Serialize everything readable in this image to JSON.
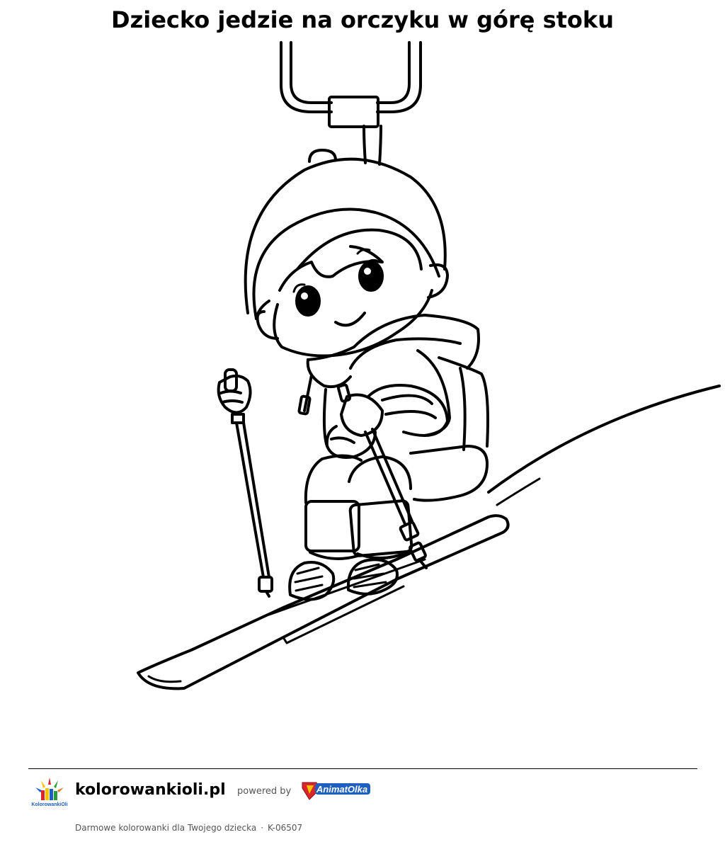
{
  "page": {
    "title": "Dziecko jedzie na orczyku w górę stoku"
  },
  "illustration": {
    "subject": "child-on-t-bar-lift",
    "style": "black-outline-coloring-page"
  },
  "footer": {
    "site_name": "kolorowankioli.pl",
    "powered_by": "powered by",
    "partner_logo_text": "AnimatOlka",
    "site_logo_text": "KolorowankiOli",
    "tagline": "Darmowe kolorowanki dla Twojego dziecka",
    "separator": "·",
    "code": "K-06507"
  },
  "colors": {
    "text": "#000000",
    "muted_text": "#555555",
    "partner_blue": "#1f5fbf",
    "partner_red": "#d9252b",
    "partner_yellow": "#f5c400"
  }
}
